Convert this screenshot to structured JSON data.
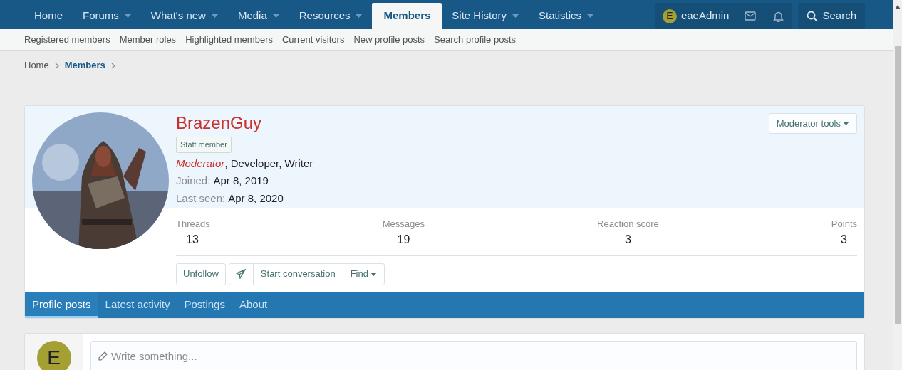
{
  "nav": {
    "tabs": [
      {
        "label": "Home",
        "dropdown": false,
        "selected": false
      },
      {
        "label": "Forums",
        "dropdown": true,
        "selected": false
      },
      {
        "label": "What's new",
        "dropdown": true,
        "selected": false
      },
      {
        "label": "Media",
        "dropdown": true,
        "selected": false
      },
      {
        "label": "Resources",
        "dropdown": true,
        "selected": false
      },
      {
        "label": "Members",
        "dropdown": false,
        "selected": true
      },
      {
        "label": "Site History",
        "dropdown": true,
        "selected": false
      },
      {
        "label": "Statistics",
        "dropdown": true,
        "selected": false
      }
    ],
    "user": {
      "initial": "E",
      "name": "eaeAdmin"
    },
    "search": "Search"
  },
  "subnav": [
    "Registered members",
    "Member roles",
    "Highlighted members",
    "Current visitors",
    "New profile posts",
    "Search profile posts"
  ],
  "breadcrumb": [
    {
      "label": "Home",
      "current": false
    },
    {
      "label": "Members",
      "current": true
    }
  ],
  "profile": {
    "name": "BrazenGuy",
    "badge": "Staff member",
    "titles": "*Moderator*, Developer, Writer",
    "info": [
      {
        "label": "Joined:",
        "value": "Apr 8, 2019"
      },
      {
        "label": "Last seen:",
        "value": "Apr 8, 2020"
      }
    ],
    "moderator_tools": "Moderator tools",
    "stats": [
      {
        "label": "Threads",
        "value": "13"
      },
      {
        "label": "Messages",
        "value": "19"
      },
      {
        "label": "Reaction score",
        "value": "3"
      },
      {
        "label": "Points",
        "value": "3"
      }
    ],
    "buttons": {
      "follow": "Unfollow",
      "conversation": "Start conversation",
      "find": "Find"
    }
  },
  "tabs": [
    {
      "label": "Profile posts",
      "selected": true
    },
    {
      "label": "Latest activity",
      "selected": false
    },
    {
      "label": "Postings",
      "selected": false
    },
    {
      "label": "About",
      "selected": false
    }
  ],
  "composer": {
    "initial": "E",
    "placeholder": "Write something..."
  }
}
